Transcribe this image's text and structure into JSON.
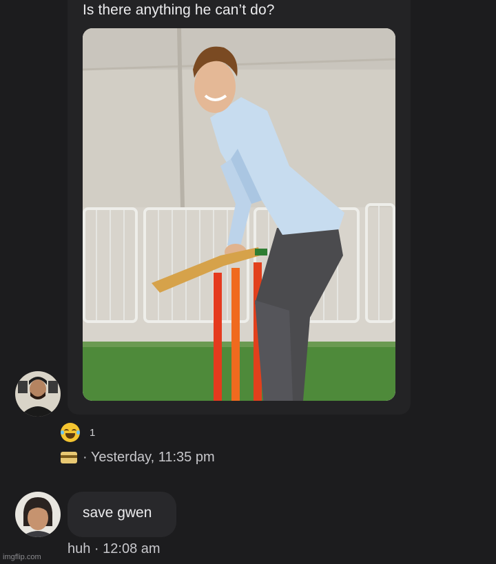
{
  "message": {
    "caption": "Is there anything he can’t do?",
    "image_icon": "photo-cricket-player",
    "reaction_icon": "tears-of-joy-emoji",
    "reaction_count": "1",
    "meta_icon": "card-icon",
    "timestamp": "· Yesterday, 11:35 pm"
  },
  "reply": {
    "text": "save gwen",
    "meta": "huh · 12:08 am"
  },
  "watermark": "imgflip.com",
  "colors": {
    "background": "#1c1c1e",
    "bubble": "#28282b",
    "text": "#ececee",
    "muted": "#c8c8cc"
  }
}
